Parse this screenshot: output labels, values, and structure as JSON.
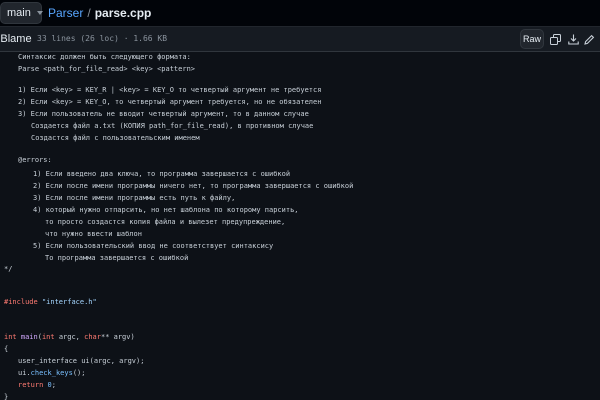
{
  "topbar": {
    "branch": "main",
    "crumb_folder": "Parser",
    "crumb_sep": "/",
    "crumb_file": "parse.cpp"
  },
  "filehead": {
    "tab_label": "Blame",
    "info": "33 lines (26 loc) · 1.66 KB",
    "raw_label": "Raw",
    "icons": [
      "copy-icon",
      "download-icon",
      "edit-icon"
    ]
  },
  "code": {
    "c1": "Синтаксис должен быть следующего формата:",
    "c2": "Parse <path_for_file_read> <key> <pattern>",
    "c3": "1) Если <key> = KEY_R | <key> = KEY_O то четвертый аргумент не требуется",
    "c4": "2) Если <key> = KEY_O, то четвертый аргумент требуется, но не обязателен",
    "c5": "3) Если пользователь не вводит четвертый аргумент, то в данном случае",
    "c6": "Создается файл a.txt (КОПИЯ path_for_file_read), в противном случае",
    "c7": "Создастся файл с пользовательским именем",
    "c8": "@errors:",
    "c9": "1) Если введено два ключа, то программа завершается с ошибкой",
    "c10": "2) Если после имени программы ничего нет, то программа завершается с ошибкой",
    "c11": "3) Если после имени программы есть путь к файлу,",
    "c12": "4) который нужно отпарсить, но нет шаблона по которому парсить,",
    "c13": "то просто создастся копия файла и вылезет предупреждение,",
    "c14": "что нужно ввести шаблон",
    "c15": "5) Если пользовательский ввод не соответствует синтаксису",
    "c16": "То программа завершается с ошибкой",
    "c17": "*/",
    "inc_kw": "#include",
    "inc_str": "\"interface.h\"",
    "m_int": "int",
    "m_name": "main",
    "m_open": "(",
    "m_int2": "int",
    "m_argc": " argc, ",
    "m_char": "char",
    "m_rest": "** argv)",
    "brace_open": "{",
    "l_ui_type": "user_interface ui(argc, argv);",
    "l_ui": "ui.",
    "l_check": "check_keys",
    "l_end": "();",
    "ret_kw": "return",
    "ret_val": "0",
    "ret_end": ";",
    "brace_close": "}"
  }
}
